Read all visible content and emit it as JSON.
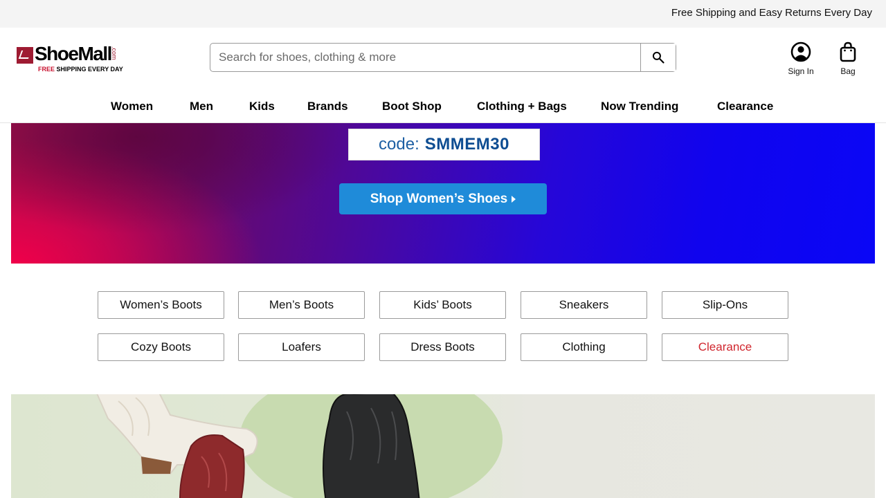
{
  "topbar": {
    "message": "Free Shipping and Easy Returns Every Day"
  },
  "logo": {
    "word": "ShoeMall",
    "suffix": ".com",
    "tag_red": "FREE",
    "tag_rest": "SHIPPING EVERY DAY"
  },
  "search": {
    "placeholder": "Search for shoes, clothing & more",
    "value": ""
  },
  "account": {
    "signin_label": "Sign In",
    "bag_label": "Bag"
  },
  "nav": [
    "Women",
    "Men",
    "Kids",
    "Brands",
    "Boot Shop",
    "Clothing + Bags",
    "Now Trending",
    "Clearance"
  ],
  "hero": {
    "code_label": "code:",
    "code_value": "SMMEM30",
    "cta_label": "Shop Women’s Shoes"
  },
  "categories": {
    "row1": [
      "Women’s Boots",
      "Men’s Boots",
      "Kids’ Boots",
      "Sneakers",
      "Slip-Ons"
    ],
    "row2": [
      "Cozy Boots",
      "Loafers",
      "Dress Boots",
      "Clothing",
      "Clearance"
    ]
  },
  "colors": {
    "brand_red": "#9e1b32",
    "clearance_red": "#d0262e",
    "cta_blue": "#1f8bd9"
  },
  "icons": {
    "search": "search-icon",
    "account": "user-circle-icon",
    "bag": "shopping-bag-icon"
  }
}
